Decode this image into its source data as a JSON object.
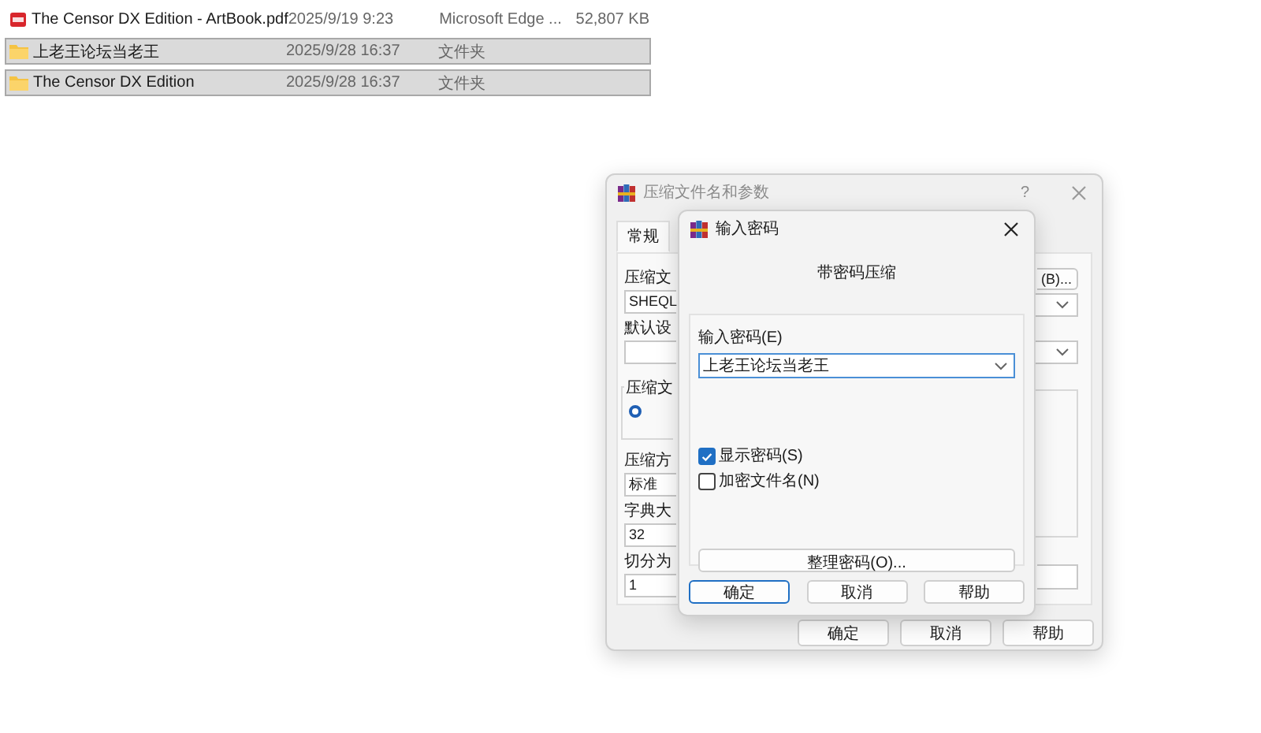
{
  "files": [
    {
      "name": "The Censor DX Edition - ArtBook.pdf",
      "modified": "2025/9/19 9:23",
      "type": "Microsoft Edge ...",
      "size": "52,807 KB",
      "kind": "pdf",
      "selected": false
    },
    {
      "name": "上老王论坛当老王",
      "modified": "2025/9/28 16:37",
      "type": "文件夹",
      "kind": "folder",
      "selected": true
    },
    {
      "name": "The Censor DX Edition",
      "modified": "2025/9/28 16:37",
      "type": "文件夹",
      "kind": "folder",
      "selected": true
    }
  ],
  "archive_dialog": {
    "title": "压缩文件名和参数",
    "help": "?",
    "tabs": [
      {
        "label": "常规",
        "selected": true
      }
    ],
    "left": [
      {
        "kind": "label",
        "text": "压缩文"
      },
      {
        "kind": "field",
        "value": "SHEQL"
      },
      {
        "kind": "label",
        "text": "默认设"
      },
      {
        "kind": "field"
      },
      {
        "kind": "group",
        "label": "压缩文",
        "radio_selected": true
      },
      {
        "kind": "label",
        "text": "压缩方"
      },
      {
        "kind": "field",
        "value": "标准"
      },
      {
        "kind": "label",
        "text": "字典大"
      },
      {
        "kind": "field",
        "value": "32"
      },
      {
        "kind": "label",
        "text": "切分为"
      },
      {
        "kind": "field",
        "value": "1"
      }
    ],
    "right": [
      {
        "kind": "button",
        "text": "(B)..."
      },
      {
        "kind": "dropdown"
      },
      {
        "kind": "dropdown"
      },
      {
        "kind": "group"
      },
      {
        "kind": "field"
      }
    ],
    "buttons": [
      {
        "label": "确定",
        "focused": false
      },
      {
        "label": "取消",
        "focused": false
      },
      {
        "label": "帮助",
        "focused": false
      }
    ]
  },
  "password_dialog": {
    "title": "输入密码",
    "heading": "带密码压缩",
    "password_label": "输入密码(E)",
    "password": "上老王论坛当老王",
    "options": [
      {
        "label": "显示密码(S)",
        "checked": true
      },
      {
        "label": "加密文件名(N)",
        "checked": false
      }
    ],
    "organize_button": "整理密码(O)...",
    "buttons": [
      {
        "label": "确定",
        "focused": true
      },
      {
        "label": "取消",
        "focused": false
      },
      {
        "label": "帮助",
        "focused": false
      }
    ]
  }
}
